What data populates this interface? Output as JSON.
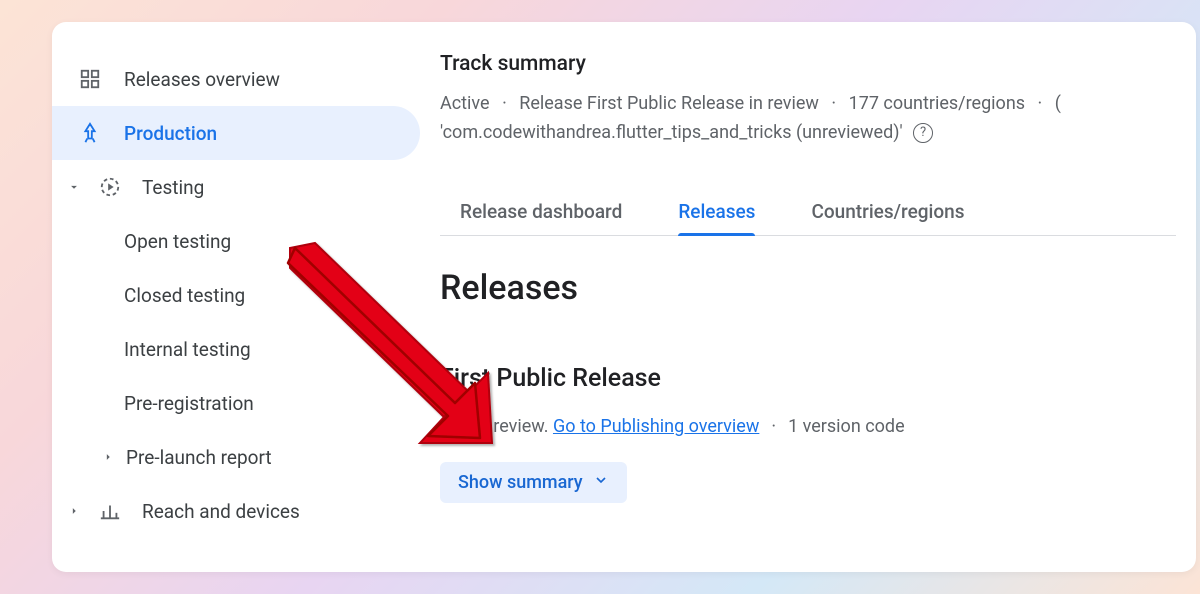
{
  "sidebar": {
    "releases_overview": "Releases overview",
    "production": "Production",
    "testing": "Testing",
    "open_testing": "Open testing",
    "closed_testing": "Closed testing",
    "internal_testing": "Internal testing",
    "pre_registration": "Pre-registration",
    "pre_launch_report": "Pre-launch report",
    "reach_devices": "Reach and devices"
  },
  "main": {
    "track_summary_title": "Track summary",
    "status": "Active",
    "release_in_review": "Release First Public Release in review",
    "countries": "177 countries/regions",
    "package_line": "'com.codewithandrea.flutter_tips_and_tricks (unreviewed)'",
    "tabs": {
      "dashboard": "Release dashboard",
      "releases": "Releases",
      "countries": "Countries/regions"
    },
    "section_heading": "Releases",
    "release": {
      "name": "First Public Release",
      "status_text": "In review.",
      "link_text": "Go to Publishing overview",
      "version_codes": "1 version code",
      "show_summary": "Show summary"
    }
  }
}
